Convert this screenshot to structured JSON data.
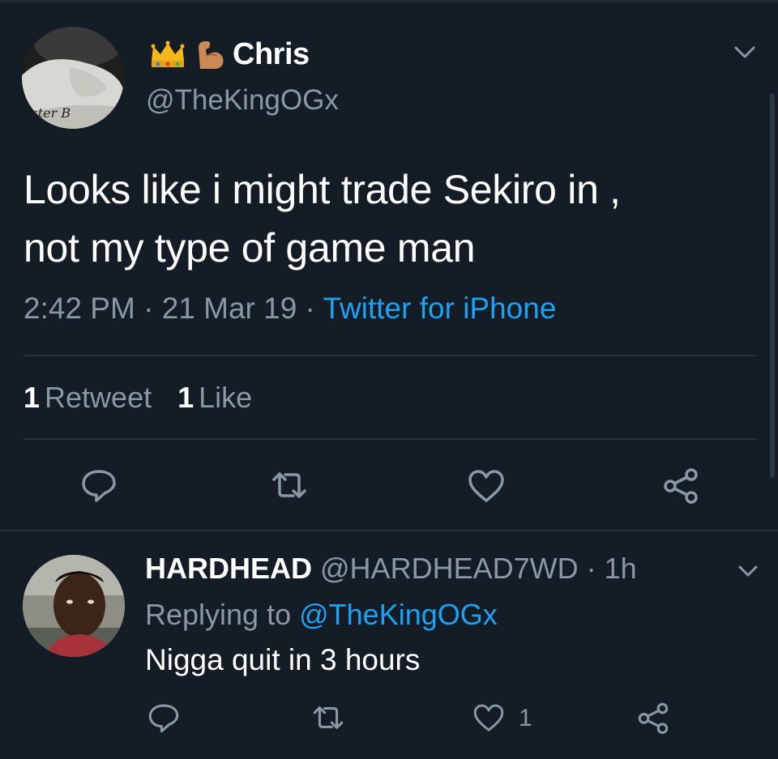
{
  "colors": {
    "background": "#141d26",
    "primary_text": "#ffffff",
    "secondary_text": "#8899a6",
    "link": "#1da1f2",
    "divider": "#26323e"
  },
  "tweet": {
    "avatar_icon": "profile-photo",
    "name_emoji": [
      "crown-icon",
      "flexed-biceps-icon"
    ],
    "display_name": "Chris",
    "handle": "@TheKingOGx",
    "avatar_caption": "aster B",
    "text_line1": "Looks like i might trade Sekiro in ,",
    "text_line2": "not my type of game man",
    "time": "2:42 PM",
    "sep1": " · ",
    "date": "21 Mar 19",
    "sep2": " · ",
    "source": "Twitter for iPhone",
    "retweet_count": "1",
    "retweet_label": "Retweet",
    "like_count": "1",
    "like_label": "Like",
    "actions": [
      "reply-icon",
      "retweet-icon",
      "like-icon",
      "share-icon"
    ]
  },
  "reply": {
    "avatar_icon": "profile-photo",
    "display_name": "HARDHEAD",
    "handle": "@HARDHEAD7WD",
    "sep": " · ",
    "age": "1h",
    "replying_prefix": "Replying to ",
    "replying_to": "@TheKingOGx",
    "text": "Nigga quit in 3 hours",
    "like_count": "1",
    "actions": [
      "reply-icon",
      "retweet-icon",
      "like-icon",
      "share-icon"
    ]
  }
}
